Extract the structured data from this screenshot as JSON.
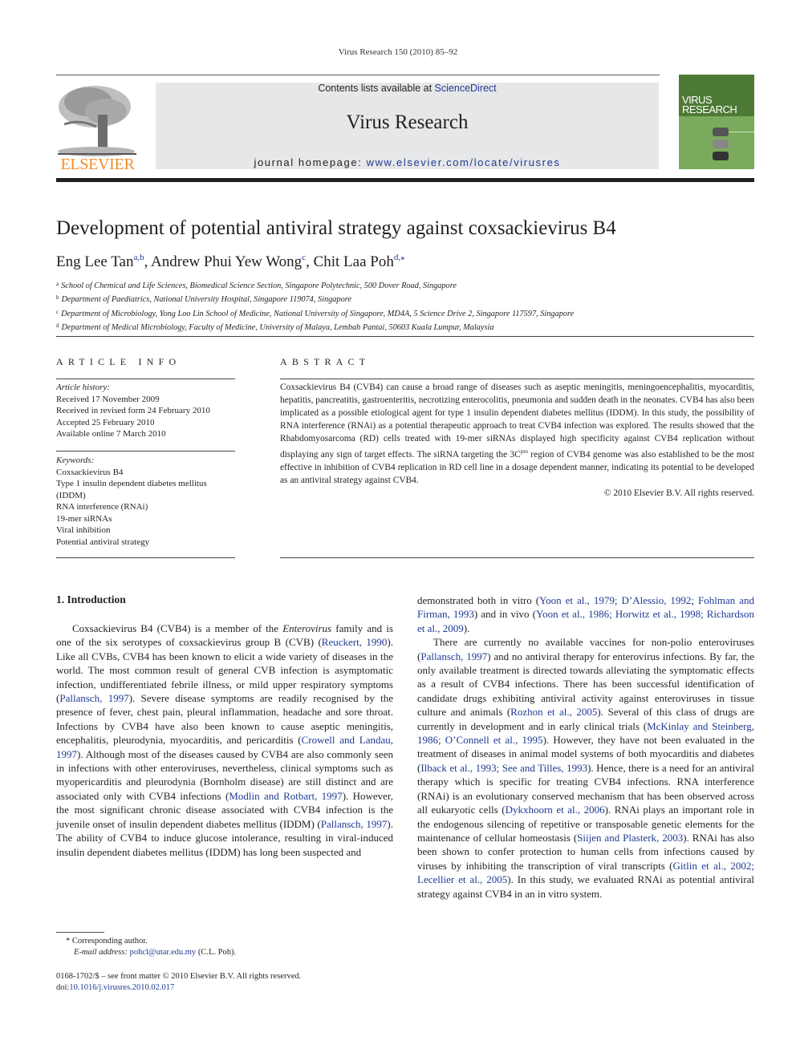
{
  "header": {
    "running_head": "Virus Research 150 (2010) 85–92",
    "contents_prefix": "Contents lists available at ",
    "contents_link": "ScienceDirect",
    "journal_name": "Virus Research",
    "homepage_prefix": "journal homepage: ",
    "homepage_link": "www.elsevier.com/locate/virusres",
    "publisher": "ELSEVIER",
    "cover_line1": "VIRUS",
    "cover_line2": "RESEARCH"
  },
  "colors": {
    "link": "#1f3a93",
    "publisher_orange": "#f28c28",
    "banner_bg": "#e6e7e8",
    "cover_green": "#7aab5c",
    "cover_dark_green": "#4d7a35"
  },
  "article": {
    "title": "Development of potential antiviral strategy against coxsackievirus B4",
    "authors": [
      {
        "name": "Eng Lee Tan",
        "sup": "a,b"
      },
      {
        "name": "Andrew Phui Yew Wong",
        "sup": "c"
      },
      {
        "name": "Chit Laa Poh",
        "sup": "d,⁎"
      }
    ],
    "affiliations": [
      {
        "mark": "a",
        "text": "School of Chemical and Life Sciences, Biomedical Science Section, Singapore Polytechnic, 500 Dover Road, Singapore"
      },
      {
        "mark": "b",
        "text": "Department of Paediatrics, National University Hospital, Singapore 119074, Singapore"
      },
      {
        "mark": "c",
        "text": "Department of Microbiology, Yong Loo Lin School of Medicine, National University of Singapore, MD4A, 5 Science Drive 2, Singapore 117597, Singapore"
      },
      {
        "mark": "d",
        "text": "Department of Medical Microbiology, Faculty of Medicine, University of Malaya, Lembah Pantai, 50603 Kuala Lumpur, Malaysia"
      }
    ]
  },
  "article_info": {
    "heading": "ARTICLE INFO",
    "history_label": "Article history:",
    "history": [
      "Received 17 November 2009",
      "Received in revised form 24 February 2010",
      "Accepted 25 February 2010",
      "Available online 7 March 2010"
    ],
    "keywords_label": "Keywords:",
    "keywords": [
      "Coxsackievirus B4",
      "Type 1 insulin dependent diabetes mellitus",
      "(IDDM)",
      "RNA interference (RNAi)",
      "19-mer siRNAs",
      "Viral inhibition",
      "Potential antiviral strategy"
    ]
  },
  "abstract": {
    "heading": "ABSTRACT",
    "text_part1": "Coxsackievirus B4 (CVB4) can cause a broad range of diseases such as aseptic meningitis, meningoencephalitis, myocarditis, hepatitis, pancreatitis, gastroenteritis, necrotizing enterocolitis, pneumonia and sudden death in the neonates. CVB4 has also been implicated as a possible etiological agent for type 1 insulin dependent diabetes mellitus (IDDM). In this study, the possibility of RNA interference (RNAi) as a potential therapeutic approach to treat CVB4 infection was explored. The results showed that the Rhabdomyosarcoma (RD) cells treated with 19-mer siRNAs displayed high specificity against CVB4 replication without displaying any sign of target effects. The siRNA targeting the 3C",
    "text_sup": "pro",
    "text_part2": " region of CVB4 genome was also established to be the most effective in inhibition of CVB4 replication in RD cell line in a dosage dependent manner, indicating its potential to be developed as an antiviral strategy against CVB4.",
    "copyright": "© 2010 Elsevier B.V. All rights reserved."
  },
  "intro": {
    "heading": "1.  Introduction",
    "left_col": [
      {
        "t": "Coxsackievirus B4 (CVB4) is a member of the "
      },
      {
        "t": "Enterovirus",
        "i": true
      },
      {
        "t": " family and is one of the six serotypes of coxsackievirus group B (CVB) ("
      },
      {
        "t": "Reuckert, 1990",
        "l": true
      },
      {
        "t": "). Like all CVBs, CVB4 has been known to elicit a wide variety of diseases in the world. The most common result of general CVB infection is asymptomatic infection, undifferentiated febrile illness, or mild upper respiratory symptoms ("
      },
      {
        "t": "Pallansch, 1997",
        "l": true
      },
      {
        "t": "). Severe disease symptoms are readily recognised by the presence of fever, chest pain, pleural inflammation, headache and sore throat. Infections by CVB4 have also been known to cause aseptic meningitis, encephalitis, pleurodynia, myocarditis, and pericarditis ("
      },
      {
        "t": "Crowell and Landau, 1997",
        "l": true
      },
      {
        "t": "). Although most of the diseases caused by CVB4 are also commonly seen in infections with other enteroviruses, nevertheless, clinical symptoms such as myopericarditis and pleurodynia (Bornholm disease) are still distinct and are associated only with CVB4 infections ("
      },
      {
        "t": "Modlin and Rotbart, 1997",
        "l": true
      },
      {
        "t": "). However, the most significant chronic disease associated with CVB4 infection is the juvenile onset of insulin dependent diabetes mellitus (IDDM) ("
      },
      {
        "t": "Pallansch, 1997",
        "l": true
      },
      {
        "t": "). The ability of CVB4 to induce glucose intolerance, resulting in viral-induced insulin dependent diabetes mellitus (IDDM) has long been suspected and"
      }
    ],
    "right_col_p1": [
      {
        "t": "demonstrated both in vitro ("
      },
      {
        "t": "Yoon et al., 1979; D’Alessio, 1992; Fohlman and Firman, 1993",
        "l": true
      },
      {
        "t": ") and in vivo ("
      },
      {
        "t": "Yoon et al., 1986; Horwitz et al., 1998; Richardson et al., 2009",
        "l": true
      },
      {
        "t": ")."
      }
    ],
    "right_col_p2": [
      {
        "t": "There are currently no available vaccines for non-polio enteroviruses ("
      },
      {
        "t": "Pallansch, 1997",
        "l": true
      },
      {
        "t": ") and no antiviral therapy for enterovirus infections. By far, the only available treatment is directed towards alleviating the symptomatic effects as a result of CVB4 infections. There has been successful identification of candidate drugs exhibiting antiviral activity against enteroviruses in tissue culture and animals ("
      },
      {
        "t": "Rozhon et al., 2005",
        "l": true
      },
      {
        "t": "). Several of this class of drugs are currently in development and in early clinical trials ("
      },
      {
        "t": "McKinlay and Steinberg, 1986; O’Connell et al., 1995",
        "l": true
      },
      {
        "t": "). However, they have not been evaluated in the treatment of diseases in animal model systems of both myocarditis and diabetes ("
      },
      {
        "t": "Ilback et al., 1993; See and Tilles, 1993",
        "l": true
      },
      {
        "t": "). Hence, there is a need for an antiviral therapy which is specific for treating CVB4 infections. RNA interference (RNAi) is an evolutionary conserved mechanism that has been observed across all eukaryotic cells ("
      },
      {
        "t": "Dykxhoorn et al., 2006",
        "l": true
      },
      {
        "t": "). RNAi plays an important role in the endogenous silencing of repetitive or transposable genetic elements for the maintenance of cellular homeostasis ("
      },
      {
        "t": "Siijen and Plasterk, 2003",
        "l": true
      },
      {
        "t": "). RNAi has also been shown to confer protection to human cells from infections caused by viruses by inhibiting the transcription of viral transcripts ("
      },
      {
        "t": "Gitlin et al., 2002; Lecellier et al., 2005",
        "l": true
      },
      {
        "t": "). In this study, we evaluated RNAi as potential antiviral strategy against CVB4 in an in vitro system."
      }
    ]
  },
  "footnotes": {
    "corresponding": "* Corresponding author.",
    "email_label": "E-mail address: ",
    "email": "pohcl@utar.edu.my",
    "email_suffix": " (C.L. Poh).",
    "front_matter": "0168-1702/$ – see front matter © 2010 Elsevier B.V. All rights reserved.",
    "doi_prefix": "doi:",
    "doi": "10.1016/j.virusres.2010.02.017"
  }
}
